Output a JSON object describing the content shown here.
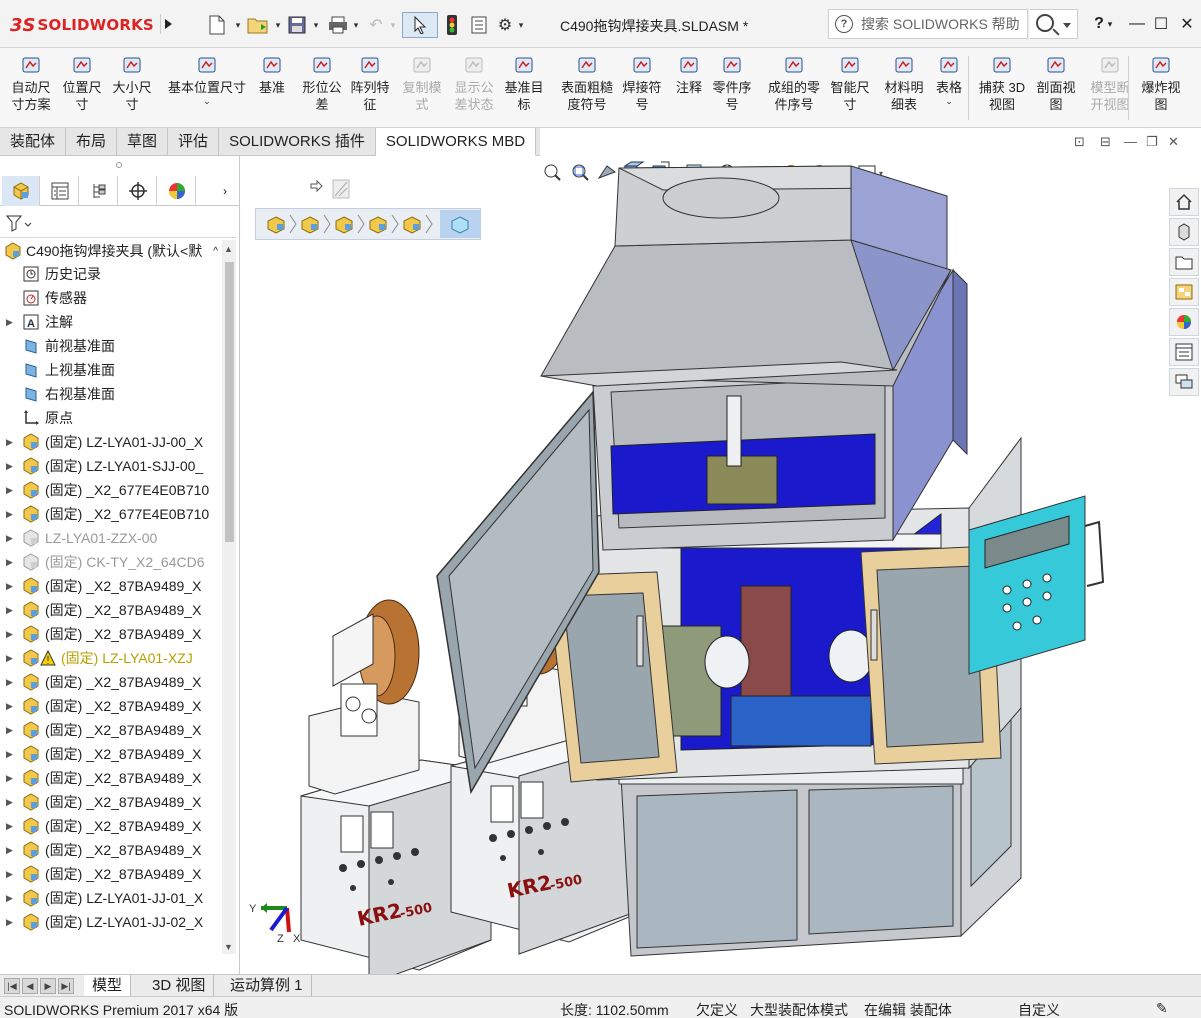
{
  "app": {
    "logo_ds": "3S",
    "logo_text": "SOLIDWORKS",
    "doc_title": "C490拖钩焊接夹具.SLDASM *",
    "search_placeholder": "搜索 SOLIDWORKS 帮助",
    "help": "?",
    "minimize": "—",
    "maximize": "☐",
    "close": "✕"
  },
  "commands": [
    {
      "label1": "自动尺",
      "label2": "寸方案",
      "icon": "auto-dimension-icon",
      "disabled": false
    },
    {
      "label1": "位置尺",
      "label2": "寸",
      "icon": "location-dimension-icon",
      "disabled": false
    },
    {
      "label1": "大小尺",
      "label2": "寸",
      "icon": "size-dimension-icon",
      "disabled": false
    },
    {
      "label1": "基本位置尺寸",
      "label2": "",
      "icon": "basic-location-dimension-icon",
      "disabled": false,
      "dropdown": "⌄"
    },
    {
      "label1": "基准",
      "label2": "",
      "icon": "datum-icon",
      "disabled": false
    },
    {
      "label1": "形位公",
      "label2": "差",
      "icon": "geometric-tolerance-icon",
      "disabled": false
    },
    {
      "label1": "阵列特",
      "label2": "征",
      "icon": "pattern-feature-icon",
      "disabled": false
    },
    {
      "label1": "复制模",
      "label2": "式",
      "icon": "copy-scheme-icon",
      "disabled": true
    },
    {
      "label1": "显示公",
      "label2": "差状态",
      "icon": "show-tolerance-status-icon",
      "disabled": true
    },
    {
      "label1": "基准目",
      "label2": "标",
      "icon": "datum-target-icon",
      "disabled": false
    },
    {
      "label1": "表面粗糙",
      "label2": "度符号",
      "icon": "surface-finish-icon",
      "disabled": false
    },
    {
      "label1": "焊接符",
      "label2": "号",
      "icon": "weld-symbol-icon",
      "disabled": false
    },
    {
      "label1": "注释",
      "label2": "",
      "icon": "note-icon",
      "disabled": false
    },
    {
      "label1": "零件序",
      "label2": "号",
      "icon": "balloon-icon",
      "disabled": false
    },
    {
      "label1": "成组的零",
      "label2": "件序号",
      "icon": "stacked-balloon-icon",
      "disabled": false
    },
    {
      "label1": "智能尺",
      "label2": "寸",
      "icon": "smart-dimension-icon",
      "disabled": false
    },
    {
      "label1": "材料明",
      "label2": "细表",
      "icon": "bom-icon",
      "disabled": false
    },
    {
      "label1": "表格",
      "label2": "",
      "icon": "table-icon",
      "disabled": false,
      "dropdown": "⌄"
    },
    {
      "label1": "捕获 3D",
      "label2": "视图",
      "icon": "capture-3d-view-icon",
      "disabled": false
    },
    {
      "label1": "剖面视",
      "label2": "图",
      "icon": "section-view-icon",
      "disabled": false
    },
    {
      "label1": "模型断",
      "label2": "开视图",
      "icon": "model-break-view-icon",
      "disabled": true
    },
    {
      "label1": "爆炸视",
      "label2": "图",
      "icon": "exploded-view-icon",
      "disabled": false
    }
  ],
  "tabs": [
    "装配体",
    "布局",
    "草图",
    "评估",
    "SOLIDWORKS 插件",
    "SOLIDWORKS MBD"
  ],
  "active_tab": 5,
  "tree": {
    "root": "C490拖钩焊接夹具  (默认<默",
    "items": [
      {
        "label": "历史记录",
        "type": "history",
        "exp": ""
      },
      {
        "label": "传感器",
        "type": "sensor",
        "exp": ""
      },
      {
        "label": "注解",
        "type": "annotation",
        "exp": "▶"
      },
      {
        "label": "前视基准面",
        "type": "plane",
        "exp": ""
      },
      {
        "label": "上视基准面",
        "type": "plane",
        "exp": ""
      },
      {
        "label": "右视基准面",
        "type": "plane",
        "exp": ""
      },
      {
        "label": "原点",
        "type": "origin",
        "exp": ""
      },
      {
        "label": "(固定) LZ-LYA01-JJ-00_X",
        "type": "asm",
        "exp": "▶"
      },
      {
        "label": "(固定) LZ-LYA01-SJJ-00_",
        "type": "asm",
        "exp": "▶"
      },
      {
        "label": "(固定) _X2_677E4E0B710",
        "type": "asm",
        "exp": "▶"
      },
      {
        "label": "(固定) _X2_677E4E0B710",
        "type": "asm",
        "exp": "▶"
      },
      {
        "label": "LZ-LYA01-ZZX-00",
        "type": "sup",
        "exp": "▶"
      },
      {
        "label": "(固定) CK-TY_X2_64CD6",
        "type": "sup",
        "exp": "▶"
      },
      {
        "label": "(固定) _X2_87BA9489_X",
        "type": "asm",
        "exp": "▶"
      },
      {
        "label": "(固定) _X2_87BA9489_X",
        "type": "asm",
        "exp": "▶"
      },
      {
        "label": "(固定) _X2_87BA9489_X",
        "type": "asm",
        "exp": "▶"
      },
      {
        "label": "(固定) LZ-LYA01-XZJ",
        "type": "warn",
        "exp": "▶"
      },
      {
        "label": "(固定) _X2_87BA9489_X",
        "type": "asm",
        "exp": "▶"
      },
      {
        "label": "(固定) _X2_87BA9489_X",
        "type": "asm",
        "exp": "▶"
      },
      {
        "label": "(固定) _X2_87BA9489_X",
        "type": "asm",
        "exp": "▶"
      },
      {
        "label": "(固定) _X2_87BA9489_X",
        "type": "asm",
        "exp": "▶"
      },
      {
        "label": "(固定) _X2_87BA9489_X",
        "type": "asm",
        "exp": "▶"
      },
      {
        "label": "(固定) _X2_87BA9489_X",
        "type": "asm",
        "exp": "▶"
      },
      {
        "label": "(固定) _X2_87BA9489_X",
        "type": "asm",
        "exp": "▶"
      },
      {
        "label": "(固定) _X2_87BA9489_X",
        "type": "asm",
        "exp": "▶"
      },
      {
        "label": "(固定) _X2_87BA9489_X",
        "type": "asm",
        "exp": "▶"
      },
      {
        "label": "(固定) LZ-LYA01-JJ-01_X",
        "type": "asm",
        "exp": "▶"
      },
      {
        "label": "(固定) LZ-LYA01-JJ-02_X",
        "type": "asm",
        "exp": "▶"
      }
    ]
  },
  "bottom_tabs": [
    "模型",
    "3D 视图",
    "运动算例 1"
  ],
  "status": {
    "product": "SOLIDWORKS Premium 2017 x64 版",
    "length": "长度: 1102.50mm",
    "defined": "欠定义",
    "mode": "大型装配体模式",
    "editing": "在编辑 装配体",
    "custom": "自定义"
  },
  "model": {
    "welder_label": "KR2-500",
    "welder_label_main": "KR2",
    "welder_label_sub": "-500"
  },
  "axes": {
    "x": "X",
    "y": "Y",
    "z": "Z"
  },
  "colors": {
    "accent": "#d22222",
    "cabinet_gray": "#a6a8ab",
    "blue_panel": "#1a1acc",
    "door_tan": "#e8cf9c",
    "glass": "#9aa6ad",
    "control_cyan": "#36c9d9"
  }
}
